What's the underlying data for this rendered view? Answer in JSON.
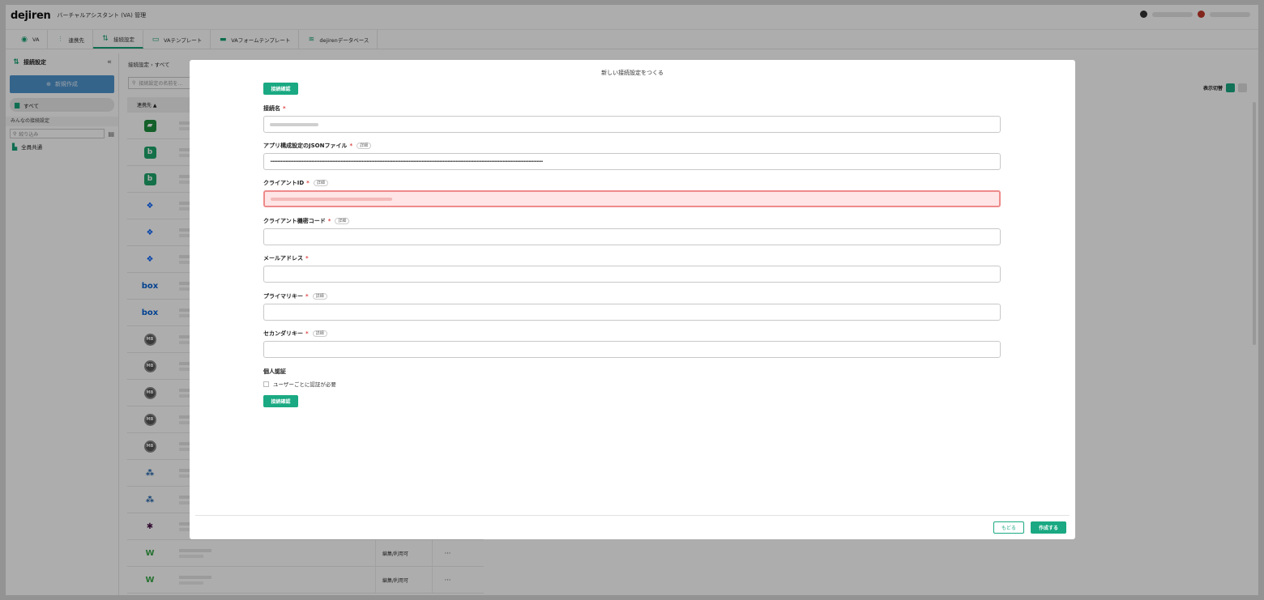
{
  "header": {
    "logo": "dejiren",
    "app_title": "バーチャルアシスタント (VA) 管理"
  },
  "nav": {
    "tabs": [
      {
        "label": "VA",
        "icon": "va-icon"
      },
      {
        "label": "連携先",
        "icon": "integration-icon"
      },
      {
        "label": "接続設定",
        "icon": "connection-settings-icon",
        "active": true
      },
      {
        "label": "VAテンプレート",
        "icon": "va-template-icon"
      },
      {
        "label": "VAフォームテンプレート",
        "icon": "form-template-icon"
      },
      {
        "label": "dejirenデータベース",
        "icon": "database-icon"
      }
    ]
  },
  "sidebar": {
    "title": "接続設定",
    "new_button": "新規作成",
    "all_label": "すべて",
    "section_label": "みんなの接続設定",
    "filter_placeholder": "絞り込み",
    "items": [
      {
        "label": "全員共通"
      }
    ]
  },
  "main": {
    "breadcrumb": "接続設定 › すべて",
    "search_placeholder": "接続設定の名前を...",
    "view_toggle_label": "表示切替",
    "table_header_service": "連携先 ▲",
    "rows": [
      {
        "icon": "google-chat-icon",
        "color": "#1e8e3e",
        "glyph": "▰"
      },
      {
        "icon": "backlog-icon",
        "color": "#1ea66b",
        "glyph": "b"
      },
      {
        "icon": "backlog-icon",
        "color": "#1ea66b",
        "glyph": "b"
      },
      {
        "icon": "dropbox-icon",
        "color": "#0061fe",
        "glyph": "❖"
      },
      {
        "icon": "dropbox-icon",
        "color": "#0061fe",
        "glyph": "❖"
      },
      {
        "icon": "dropbox-icon",
        "color": "#0061fe",
        "glyph": "❖"
      },
      {
        "icon": "box-icon",
        "color": "#0061d5",
        "glyph": "box"
      },
      {
        "icon": "box-icon",
        "color": "#0061d5",
        "glyph": "box"
      },
      {
        "icon": "mb-icon",
        "color": "#555555",
        "glyph": "MB"
      },
      {
        "icon": "mb-icon",
        "color": "#555555",
        "glyph": "MB"
      },
      {
        "icon": "mb-icon",
        "color": "#555555",
        "glyph": "MB"
      },
      {
        "icon": "mb-icon",
        "color": "#555555",
        "glyph": "MB"
      },
      {
        "icon": "mb-icon",
        "color": "#555555",
        "glyph": "MB"
      },
      {
        "icon": "node-icon",
        "color": "#1a5fa8",
        "glyph": "⁂"
      },
      {
        "icon": "node-icon",
        "color": "#1a5fa8",
        "glyph": "⁂"
      },
      {
        "icon": "slack-icon",
        "color": "#4a154b",
        "glyph": "✱"
      },
      {
        "icon": "w-icon",
        "color": "#3aa84a",
        "glyph": "W",
        "perm": "編集/利用可",
        "more": "···"
      },
      {
        "icon": "w-icon",
        "color": "#3aa84a",
        "glyph": "W",
        "perm": "編集/利用可",
        "more": "···"
      }
    ]
  },
  "modal": {
    "title": "新しい接続設定をつくる",
    "connect_top": "接続確認",
    "fields": [
      {
        "label": "接続名",
        "required": true,
        "detail": "",
        "value": "",
        "masked": false,
        "blurred": true,
        "error": false
      },
      {
        "label": "アプリ構成設定のJSONファイル",
        "required": true,
        "detail": "詳細",
        "value": "••••••••••••••••••••••••••••••••••••••••••••••••••••••••••••••••••••••••••••••••••••••••••••••••••••••••••••••••••••••••••••••••••••••••••••••••••••••••••••••••••••••••••••••••••••••••••••••••••••••••••••••••••••••••••••••••••••••••",
        "masked": true,
        "blurred": false,
        "error": false
      },
      {
        "label": "クライアントID",
        "required": true,
        "detail": "詳細",
        "value": "",
        "masked": false,
        "blurred": true,
        "error": true
      },
      {
        "label": "クライアント機密コード",
        "required": true,
        "detail": "詳細",
        "value": "",
        "masked": false,
        "blurred": false,
        "error": false
      },
      {
        "label": "メールアドレス",
        "required": true,
        "detail": "",
        "value": "",
        "masked": false,
        "blurred": false,
        "error": false
      },
      {
        "label": "プライマリキー",
        "required": true,
        "detail": "詳細",
        "value": "",
        "masked": false,
        "blurred": false,
        "error": false
      },
      {
        "label": "セカンダリキー",
        "required": true,
        "detail": "詳細",
        "value": "",
        "masked": false,
        "blurred": false,
        "error": false
      }
    ],
    "personal_auth_title": "個人認証",
    "personal_auth_checkbox": "ユーザーごとに認証が必要",
    "connect_bottom": "接続確認",
    "back_button": "もどる",
    "create_button": "作成する",
    "required_mark": "*"
  },
  "colors": {
    "accent": "#1aa982",
    "error_bg": "#ffe5e5",
    "error_border": "#ee8a8a",
    "new_button": "#4f94cd"
  }
}
